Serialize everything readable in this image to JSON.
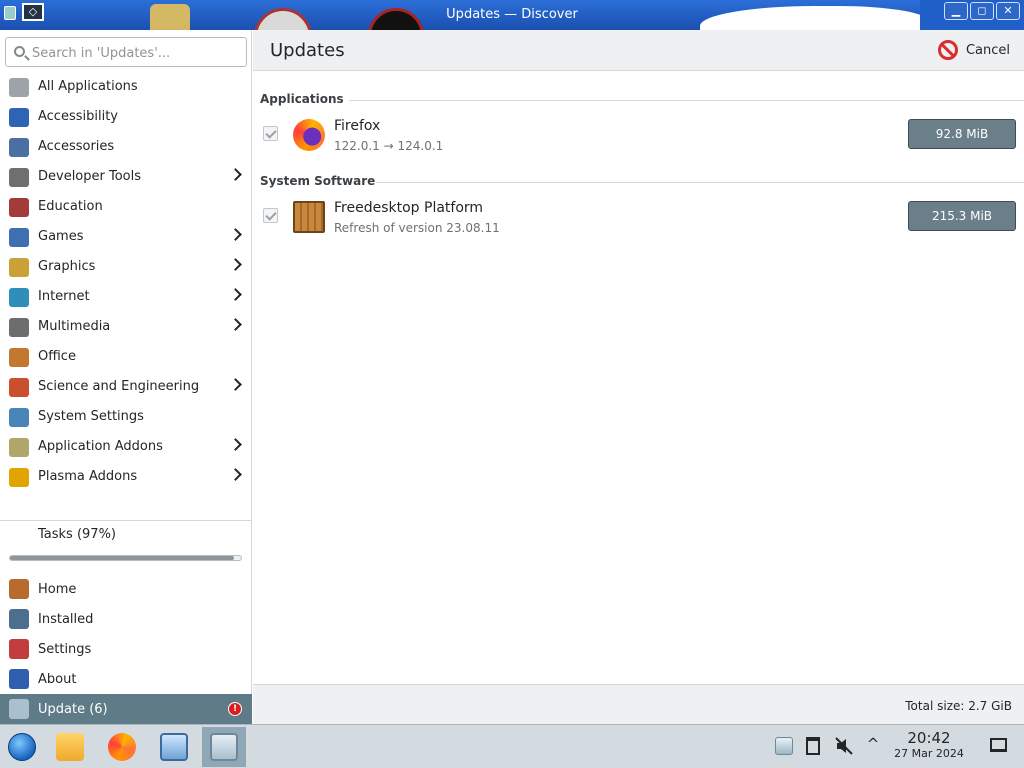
{
  "window": {
    "title": "Updates — Discover",
    "controls": {
      "minimize": "▁",
      "maximize": "◻",
      "close": "✕"
    },
    "menu_glyph": "◇"
  },
  "sidebar": {
    "search_placeholder": "Search in 'Updates'...",
    "categories": [
      {
        "label": "All Applications",
        "icon": "grid-icon",
        "color": "#9da3a7",
        "submenu": false
      },
      {
        "label": "Accessibility",
        "icon": "accessibility-icon",
        "color": "#2f63b5",
        "submenu": false
      },
      {
        "label": "Accessories",
        "icon": "accessories-icon",
        "color": "#4b6fa2",
        "submenu": false
      },
      {
        "label": "Developer Tools",
        "icon": "developer-tools-icon",
        "color": "#6f6f6f",
        "submenu": true
      },
      {
        "label": "Education",
        "icon": "education-icon",
        "color": "#a33b3b",
        "submenu": false
      },
      {
        "label": "Games",
        "icon": "games-icon",
        "color": "#3d6fb1",
        "submenu": true
      },
      {
        "label": "Graphics",
        "icon": "graphics-icon",
        "color": "#c9a137",
        "submenu": true
      },
      {
        "label": "Internet",
        "icon": "internet-icon",
        "color": "#2f8fb8",
        "submenu": true
      },
      {
        "label": "Multimedia",
        "icon": "multimedia-icon",
        "color": "#6d6d6d",
        "submenu": true
      },
      {
        "label": "Office",
        "icon": "office-icon",
        "color": "#c2792e",
        "submenu": false
      },
      {
        "label": "Science and Engineering",
        "icon": "science-icon",
        "color": "#c94f2e",
        "submenu": true
      },
      {
        "label": "System Settings",
        "icon": "system-settings-icon",
        "color": "#4a85b7",
        "submenu": false
      },
      {
        "label": "Application Addons",
        "icon": "addons-icon",
        "color": "#b0a56b",
        "submenu": true
      },
      {
        "label": "Plasma Addons",
        "icon": "plasma-addons-icon",
        "color": "#e2a400",
        "submenu": true
      }
    ],
    "tasks": {
      "label": "Tasks (97%)",
      "progress": 0.97
    },
    "nav": [
      {
        "label": "Home",
        "icon": "home-icon",
        "color": "#b86b2f",
        "active": false
      },
      {
        "label": "Installed",
        "icon": "installed-list-icon",
        "color": "#4d6f8f",
        "active": false
      },
      {
        "label": "Settings",
        "icon": "settings-tools-icon",
        "color": "#c23d3d",
        "active": false
      },
      {
        "label": "About",
        "icon": "info-icon",
        "color": "#2f5fae",
        "active": false
      },
      {
        "label": "Update (6)",
        "icon": "update-icon",
        "color": "#a9c0cf",
        "active": true,
        "badge": "!"
      }
    ]
  },
  "main": {
    "title": "Updates",
    "cancel_label": "Cancel",
    "sections": [
      {
        "title": "Applications",
        "items": [
          {
            "name": "Firefox",
            "detail": "122.0.1 → 124.0.1",
            "size": "92.8 MiB",
            "icon": "firefox-icon",
            "checked": true
          }
        ]
      },
      {
        "title": "System Software",
        "items": [
          {
            "name": "Freedesktop Platform",
            "detail": "Refresh of version 23.08.11",
            "size": "215.3 MiB",
            "icon": "package-crate-icon",
            "checked": true
          }
        ]
      }
    ],
    "total_size": "Total size: 2.7 GiB"
  },
  "panel": {
    "clock_time": "20:42",
    "clock_date": "27 Mar 2024",
    "chevron_glyph": "^",
    "colors": {
      "panel": "#d3dbe1",
      "active_task": "#8ea8b6",
      "accent": "#5f7b88"
    }
  }
}
